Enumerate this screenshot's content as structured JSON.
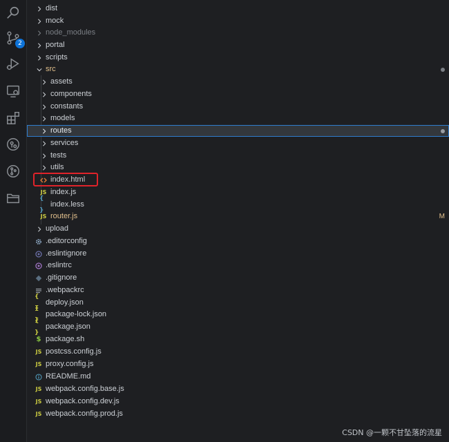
{
  "activity_bar": {
    "icons": [
      "search-icon",
      "source-control-icon",
      "run-debug-icon",
      "remote-explorer-icon",
      "extensions-icon",
      "gitlens-icon",
      "git-graph-icon",
      "folder-icon"
    ],
    "source_control_badge": "2",
    "badge_color": "#0e73d8"
  },
  "explorer": {
    "items": [
      {
        "label": "dist"
      },
      {
        "label": "mock"
      },
      {
        "label": "node_modules"
      },
      {
        "label": "portal"
      },
      {
        "label": "scripts"
      },
      {
        "label": "src"
      },
      {
        "label": "assets"
      },
      {
        "label": "components"
      },
      {
        "label": "constants"
      },
      {
        "label": "models"
      },
      {
        "label": "routes"
      },
      {
        "label": "services"
      },
      {
        "label": "tests"
      },
      {
        "label": "utils"
      },
      {
        "label": "index.html"
      },
      {
        "label": "index.js"
      },
      {
        "label": "index.less"
      },
      {
        "label": "router.js",
        "status": "M"
      },
      {
        "label": "upload"
      },
      {
        "label": ".editorconfig"
      },
      {
        "label": ".eslintignore"
      },
      {
        "label": ".eslintrc"
      },
      {
        "label": ".gitignore"
      },
      {
        "label": ".webpackrc"
      },
      {
        "label": "deploy.json"
      },
      {
        "label": "package-lock.json"
      },
      {
        "label": "package.json"
      },
      {
        "label": "package.sh"
      },
      {
        "label": "postcss.config.js"
      },
      {
        "label": "proxy.config.js"
      },
      {
        "label": "README.md"
      },
      {
        "label": "webpack.config.base.js"
      },
      {
        "label": "webpack.config.dev.js"
      },
      {
        "label": "webpack.config.prod.js"
      }
    ]
  },
  "icon_glyphs": {
    "js": "JS",
    "json": "{ }",
    "less": "{ }",
    "sh": "$"
  },
  "colors": {
    "js_icon": "#cbcb41",
    "json_icon": "#cbcb41",
    "less_icon": "#519aba",
    "html_icon": "#e37933",
    "modified": "#e2c08d",
    "highlight": "#e0232a",
    "selection_border": "#2f7dcf"
  },
  "watermark": "CSDN @一颗不甘坠落的流星"
}
